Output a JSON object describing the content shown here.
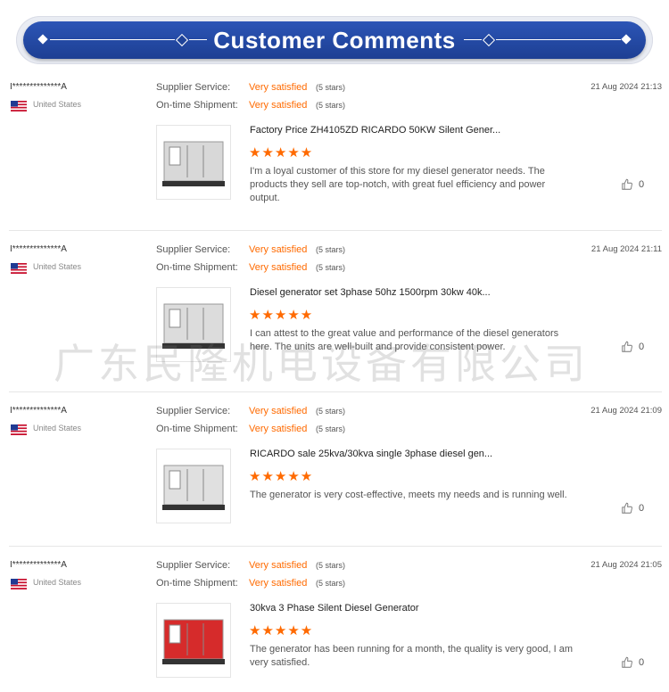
{
  "header": {
    "title": "Customer Comments"
  },
  "labels": {
    "supplier_service": "Supplier Service:",
    "shipment": "On-time Shipment:"
  },
  "watermark": "广东民隆机电设备有限公司",
  "reviews": [
    {
      "user": "I**************A",
      "country": "United States",
      "service_value": "Very satisfied",
      "service_stars": "(5 stars)",
      "shipment_value": "Very satisfied",
      "shipment_stars": "(5 stars)",
      "date": "21 Aug 2024 21:13",
      "product_title": "Factory Price ZH4105ZD RICARDO 50KW Silent Gener...",
      "rating": "★★★★★",
      "comment": "I'm a loyal customer of this store for my diesel generator needs. The products they sell are top-notch, with great fuel efficiency and power output.",
      "likes": "0",
      "image_color": "#d8d8d8"
    },
    {
      "user": "I**************A",
      "country": "United States",
      "service_value": "Very satisfied",
      "service_stars": "(5 stars)",
      "shipment_value": "Very satisfied",
      "shipment_stars": "(5 stars)",
      "date": "21 Aug 2024 21:11",
      "product_title": "Diesel generator set 3phase 50hz 1500rpm 30kw 40k...",
      "rating": "★★★★★",
      "comment": "I can attest to the great value and performance of the diesel generators here. The units are well-built and provide consistent power.",
      "likes": "0",
      "image_color": "#dcdcdc"
    },
    {
      "user": "I**************A",
      "country": "United States",
      "service_value": "Very satisfied",
      "service_stars": "(5 stars)",
      "shipment_value": "Very satisfied",
      "shipment_stars": "(5 stars)",
      "date": "21 Aug 2024 21:09",
      "product_title": "RICARDO sale 25kva/30kva single 3phase diesel gen...",
      "rating": "★★★★★",
      "comment": "The generator is very cost-effective, meets my needs and is running well.",
      "likes": "0",
      "image_color": "#e0e0e0"
    },
    {
      "user": "I**************A",
      "country": "United States",
      "service_value": "Very satisfied",
      "service_stars": "(5 stars)",
      "shipment_value": "Very satisfied",
      "shipment_stars": "(5 stars)",
      "date": "21 Aug 2024 21:05",
      "product_title": "30kva 3 Phase Silent Diesel Generator",
      "rating": "★★★★★",
      "comment": "The generator has been running for a month, the quality is very good, I am very satisfied.",
      "likes": "0",
      "image_color": "#d62b2b"
    }
  ]
}
